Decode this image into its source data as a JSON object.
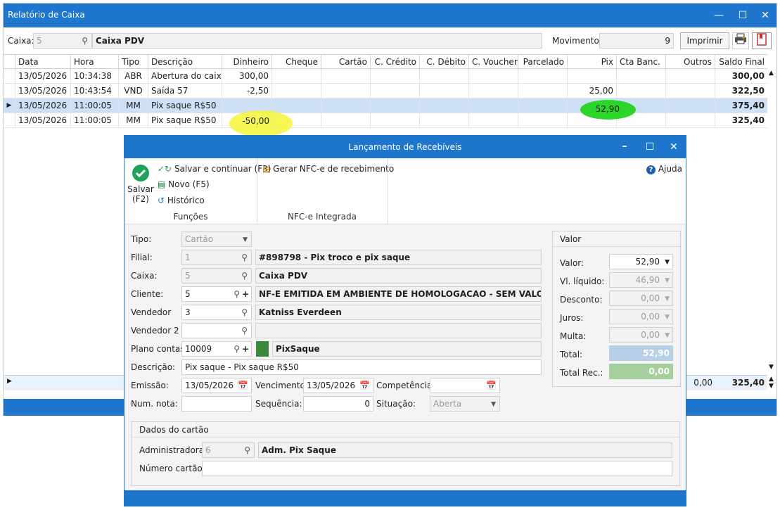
{
  "main_window": {
    "title": "Relatório de Caixa",
    "caixa_label": "Caixa:",
    "caixa_code": "5",
    "caixa_name": "Caixa PDV",
    "movimento_label": "Movimento:",
    "movimento_value": "9",
    "print_button": "Imprimir"
  },
  "grid": {
    "columns": [
      "Data",
      "Hora",
      "Tipo",
      "Descrição",
      "Dinheiro",
      "Cheque",
      "Cartão",
      "C. Crédito",
      "C. Débito",
      "C. Voucher",
      "Parcelado",
      "Pix",
      "Cta Banc.",
      "Outros",
      "Saldo Final"
    ],
    "rows": [
      {
        "data": "13/05/2026",
        "hora": "10:34:38",
        "tipo": "ABR",
        "descricao": "Abertura do caixa",
        "dinheiro": "300,00",
        "pix": "",
        "saldo": "300,00"
      },
      {
        "data": "13/05/2026",
        "hora": "10:43:54",
        "tipo": "VND",
        "descricao": "Saída 57",
        "dinheiro": "-2,50",
        "pix": "25,00",
        "saldo": "322,50"
      },
      {
        "data": "13/05/2026",
        "hora": "11:00:05",
        "tipo": "MM",
        "descricao": "Pix saque R$50",
        "dinheiro": "",
        "pix": "52,90",
        "saldo": "375,40"
      },
      {
        "data": "13/05/2026",
        "hora": "11:00:05",
        "tipo": "MM",
        "descricao": "Pix saque R$50",
        "dinheiro": "-50,00",
        "pix": "",
        "saldo": "325,40"
      }
    ],
    "totals": {
      "outros": "0,00",
      "saldo": "325,40"
    }
  },
  "dialog": {
    "title": "Lançamento de Recebíveis",
    "ribbon": {
      "salvar": "Salvar",
      "salvar_key": "(F2)",
      "salvar_continuar": "Salvar e continuar (F3)",
      "novo": "Novo (F5)",
      "historico": "Histórico",
      "funcoes": "Funções",
      "gerar_nfce": "Gerar NFC-e de recebimento",
      "nfce_integrada": "NFC-e Integrada",
      "ajuda": "Ajuda"
    },
    "form": {
      "tipo_label": "Tipo:",
      "tipo_value": "Cartão",
      "filial_label": "Filial:",
      "filial_code": "1",
      "filial_name": "#898798 - Pix troco e pix saque",
      "caixa_label": "Caixa:",
      "caixa_code": "5",
      "caixa_name": "Caixa PDV",
      "cliente_label": "Cliente:",
      "cliente_code": "5",
      "cliente_name": "NF-E EMITIDA EM AMBIENTE DE HOMOLOGACAO - SEM VALOR FISCAL",
      "vendedor_label": "Vendedor",
      "vendedor_code": "3",
      "vendedor_name": "Katniss Everdeen",
      "vendedor2_label": "Vendedor 2",
      "vendedor2_code": "",
      "vendedor2_name": "",
      "plano_label": "Plano contas:",
      "plano_code": "10009",
      "plano_name": "PixSaque",
      "descricao_label": "Descrição:",
      "descricao_value": "Pix saque - Pix saque R$50",
      "emissao_label": "Emissão:",
      "emissao_value": "13/05/2026",
      "vencimento_label": "Vencimento:",
      "vencimento_value": "13/05/2026",
      "competencia_label": "Competência:",
      "competencia_value": "",
      "numnota_label": "Num. nota:",
      "numnota_value": "",
      "sequencia_label": "Sequência:",
      "sequencia_value": "0",
      "situacao_label": "Situação:",
      "situacao_value": "Aberta"
    },
    "valor": {
      "title": "Valor",
      "valor_label": "Valor:",
      "valor_value": "52,90",
      "liquido_label": "Vl. líquido:",
      "liquido_value": "46,90",
      "desconto_label": "Desconto:",
      "desconto_value": "0,00",
      "juros_label": "Juros:",
      "juros_value": "0,00",
      "multa_label": "Multa:",
      "multa_value": "0,00",
      "total_label": "Total:",
      "total_value": "52,90",
      "totalrec_label": "Total Rec.:",
      "totalrec_value": "0,00"
    },
    "cartao": {
      "title": "Dados do cartão",
      "adm_label": "Administradora:",
      "adm_code": "6",
      "adm_name": "Adm. Pix Saque",
      "numero_label": "Número cartão:",
      "numero_value": ""
    }
  },
  "colors": {
    "titlebar": "#1e77cc",
    "plano_color": "#3a8a3a",
    "highlight_yellow": "#f5f53a",
    "highlight_green": "#22d41e"
  }
}
